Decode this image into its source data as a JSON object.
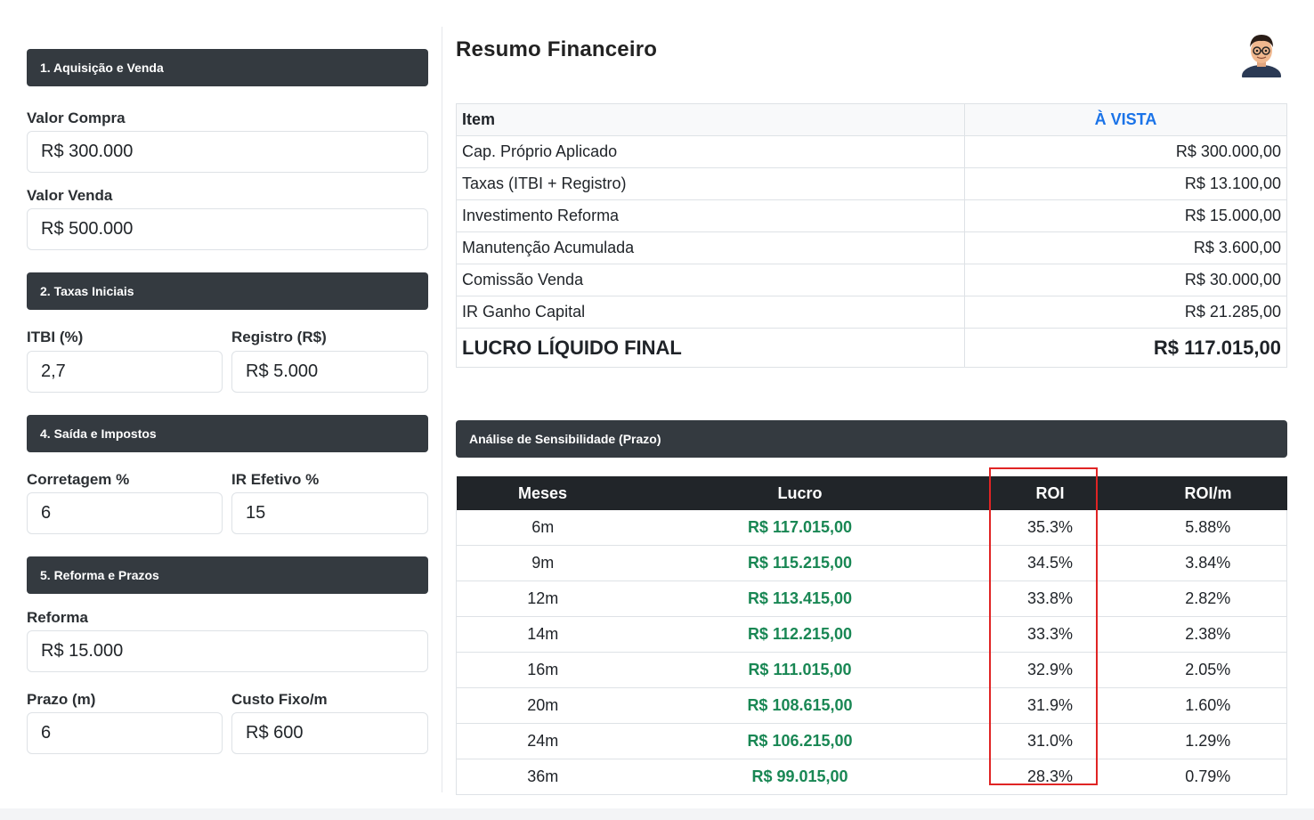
{
  "left": {
    "section1": {
      "title": "1. Aquisição e Venda"
    },
    "valor_compra": {
      "label": "Valor Compra",
      "value": "R$ 300.000"
    },
    "valor_venda": {
      "label": "Valor Venda",
      "value": "R$ 500.000"
    },
    "section2": {
      "title": "2. Taxas Iniciais"
    },
    "itbi": {
      "label": "ITBI (%)",
      "value": "2,7"
    },
    "registro": {
      "label": "Registro (R$)",
      "value": "R$ 5.000"
    },
    "section4": {
      "title": "4. Saída e Impostos"
    },
    "corretagem": {
      "label": "Corretagem %",
      "value": "6"
    },
    "ir_efetivo": {
      "label": "IR Efetivo %",
      "value": "15"
    },
    "section5": {
      "title": "5. Reforma e Prazos"
    },
    "reforma": {
      "label": "Reforma",
      "value": "R$ 15.000"
    },
    "prazo": {
      "label": "Prazo (m)",
      "value": "6"
    },
    "custo_fixo": {
      "label": "Custo Fixo/m",
      "value": "R$ 600"
    }
  },
  "summary": {
    "title": "Resumo Financeiro",
    "col_item": "Item",
    "col_vista": "À VISTA",
    "rows": [
      {
        "item": "Cap. Próprio Aplicado",
        "value": "R$ 300.000,00"
      },
      {
        "item": "Taxas (ITBI + Registro)",
        "value": "R$ 13.100,00"
      },
      {
        "item": "Investimento Reforma",
        "value": "R$ 15.000,00"
      },
      {
        "item": "Manutenção Acumulada",
        "value": "R$ 3.600,00"
      },
      {
        "item": "Comissão Venda",
        "value": "R$ 30.000,00"
      },
      {
        "item": "IR Ganho Capital",
        "value": "R$ 21.285,00"
      }
    ],
    "total": {
      "item": "LUCRO LÍQUIDO FINAL",
      "value": "R$ 117.015,00"
    }
  },
  "sensitivity": {
    "title": "Análise de Sensibilidade (Prazo)",
    "headers": [
      "Meses",
      "Lucro",
      "ROI",
      "ROI/m"
    ],
    "rows": [
      {
        "meses": "6m",
        "lucro": "R$ 117.015,00",
        "roi": "35.3%",
        "roim": "5.88%"
      },
      {
        "meses": "9m",
        "lucro": "R$ 115.215,00",
        "roi": "34.5%",
        "roim": "3.84%"
      },
      {
        "meses": "12m",
        "lucro": "R$ 113.415,00",
        "roi": "33.8%",
        "roim": "2.82%"
      },
      {
        "meses": "14m",
        "lucro": "R$ 112.215,00",
        "roi": "33.3%",
        "roim": "2.38%"
      },
      {
        "meses": "16m",
        "lucro": "R$ 111.015,00",
        "roi": "32.9%",
        "roim": "2.05%"
      },
      {
        "meses": "20m",
        "lucro": "R$ 108.615,00",
        "roi": "31.9%",
        "roim": "1.60%"
      },
      {
        "meses": "24m",
        "lucro": "R$ 106.215,00",
        "roi": "31.0%",
        "roim": "1.29%"
      },
      {
        "meses": "36m",
        "lucro": "R$ 99.015,00",
        "roi": "28.3%",
        "roim": "0.79%"
      }
    ]
  },
  "colors": {
    "header_dark": "#343a40",
    "table_head": "#212529",
    "accent_blue": "#1a73e8",
    "profit_green": "#198754",
    "highlight_red": "#e02424"
  }
}
